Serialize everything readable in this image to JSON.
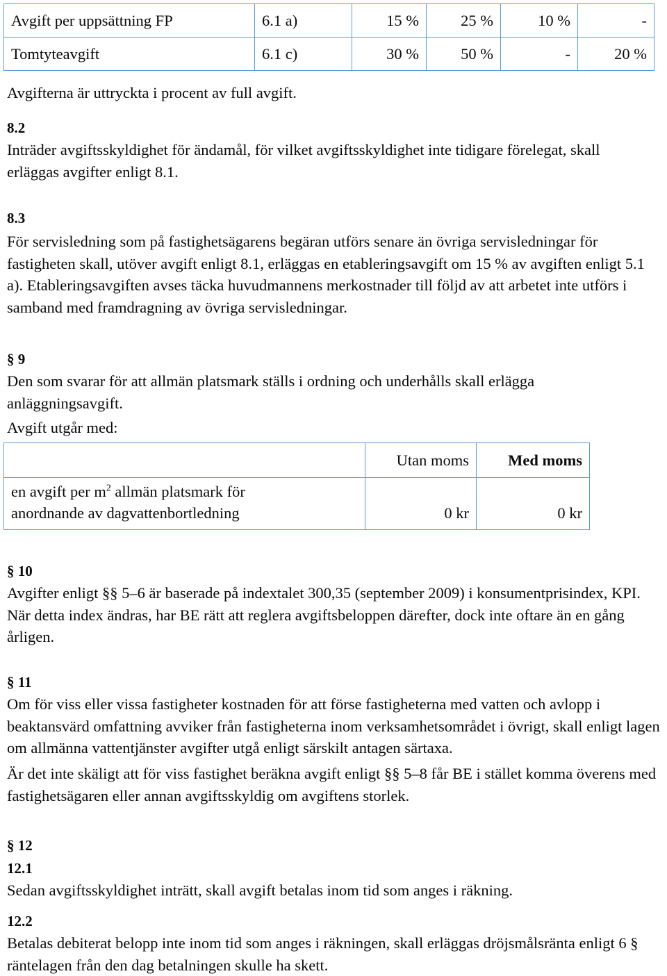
{
  "document": {
    "language": "sv",
    "border_color": "#5b9bd5",
    "text_color": "#0a0a0a",
    "background": "#ffffff"
  },
  "fees_table": {
    "rows": [
      {
        "label": "Avgift per uppsättning FP",
        "reference": "6.1 a)",
        "values": [
          "15 %",
          "25 %",
          "10 %",
          "-"
        ]
      },
      {
        "label": "Tomtyteavgift",
        "reference": "6.1 c)",
        "values": [
          "30 %",
          "50 %",
          "-",
          "20 %"
        ]
      }
    ]
  },
  "note_after_table": "Avgifterna är uttryckta i procent av full avgift.",
  "sections": {
    "s8_2": {
      "heading": "8.2",
      "body": "Inträder avgiftsskyldighet för ändamål, för vilket avgiftsskyldighet inte tidigare förelegat, skall erläggas avgifter enligt 8.1."
    },
    "s8_3": {
      "heading": "8.3",
      "body": "För servisledning som på fastighetsägarens begäran utförs senare än övriga servisledningar för fastigheten skall, utöver avgift enligt 8.1, erläggas en etableringsavgift om 15 % av avgiften enligt 5.1 a). Etableringsavgiften avses täcka huvudmannens merkostnader till följd av att arbetet inte utförs i samband med framdragning av övriga servisledningar."
    },
    "s9": {
      "heading": "§ 9",
      "body": "Den som svarar för att allmän platsmark ställs i ordning och underhålls skall erlägga anläggningsavgift.",
      "lead_in": "Avgift utgår med:"
    },
    "s10": {
      "heading": "§ 10",
      "body": "Avgifter enligt §§ 5–6 är baserade på indextalet 300,35 (september 2009) i konsumentprisindex, KPI. När detta index ändras, har BE rätt att reglera avgiftsbeloppen därefter, dock inte oftare än en gång årligen."
    },
    "s11": {
      "heading": "§ 11",
      "body_1": "Om för viss eller vissa fastigheter kostnaden för att förse fastigheterna med vatten och avlopp i beaktansvärd omfattning avviker från fastigheterna inom verksamhetsområdet i övrigt, skall enligt lagen om allmänna vattentjänster avgifter utgå enligt särskilt antagen särtaxa.",
      "body_2": "Är det inte skäligt att för viss fastighet beräkna avgift enligt §§ 5–8 får BE i stället komma överens med fastighetsägaren eller annan avgiftsskyldig om avgiftens storlek."
    },
    "s12": {
      "heading": "§ 12",
      "sub_12_1": {
        "heading": "12.1",
        "body": "Sedan avgiftsskyldighet inträtt, skall avgift betalas inom tid som anges i räkning."
      },
      "sub_12_2": {
        "heading": "12.2",
        "body": "Betalas debiterat belopp inte inom tid som anges i räkningen, skall erläggas dröjsmålsränta enligt 6 § räntelagen från den dag betalningen skulle ha skett."
      }
    }
  },
  "charge_table": {
    "header": {
      "blank": "",
      "without_vat": "Utan moms",
      "with_vat": "Med moms"
    },
    "row": {
      "description_line1_pre": "en avgift per m",
      "description_line1_sup": "2",
      "description_line1_post": " allmän platsmark för",
      "description_line2": "anordnande av dagvattenbortledning",
      "without_vat": "0 kr",
      "with_vat": "0 kr"
    }
  }
}
